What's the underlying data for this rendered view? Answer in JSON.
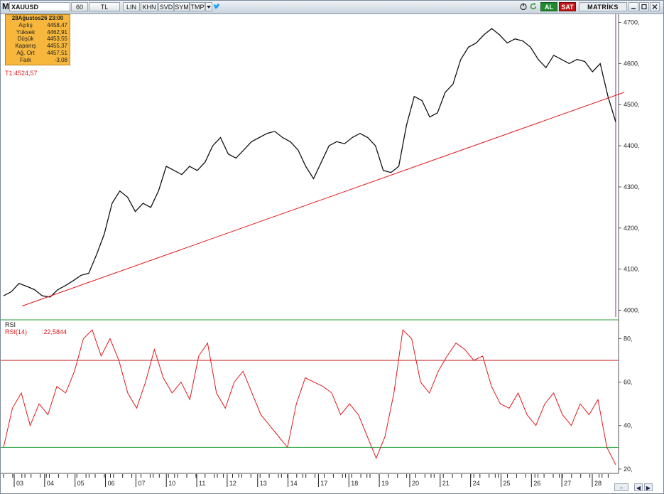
{
  "toolbar": {
    "logo": "M",
    "symbol": "XAUUSD",
    "period": "60",
    "currency": "TL",
    "buttons": [
      "LIN",
      "KHN",
      "SVD",
      "SYM",
      "TMP"
    ],
    "dropdown_icon": "triangle-down-icon",
    "twitter_icon": "twitter-icon",
    "refresh_icon": "refresh-icon",
    "power_icon": "power-icon",
    "buy_label": "AL",
    "sell_label": "SAT",
    "brand": "MATRİKS",
    "window_icons": [
      "minimize-icon",
      "maximize-icon",
      "close-icon"
    ]
  },
  "info": {
    "date": "28Ağustos26 23:00",
    "rows": [
      {
        "label": "Açılış",
        "value": "4458,47"
      },
      {
        "label": "Yüksek",
        "value": "4462,91"
      },
      {
        "label": "Düşük",
        "value": "4453,55"
      },
      {
        "label": "Kapanış",
        "value": "4455,37"
      },
      {
        "label": "Ağ. Ort",
        "value": "4457,51"
      },
      {
        "label": "Fark",
        "value": "-3,08"
      }
    ]
  },
  "colors": {
    "price": "#111111",
    "trendline": "#e0191c",
    "rsi": "#e0191c",
    "rsi_upper": "#c0151a",
    "rsi_lower": "#1e9e35",
    "cursor": "#9a1fb0"
  },
  "chart_data": [
    {
      "type": "line",
      "title": "",
      "trendline_label": "T1:4524,57",
      "ylim": [
        3980,
        4720
      ],
      "yticks": [
        4000,
        4100,
        4200,
        4300,
        4400,
        4500,
        4600,
        4700
      ],
      "ytick_labels": [
        "4000,",
        "4100,",
        "4200,",
        "4300,",
        "4400,",
        "4500,",
        "4600,",
        "4700,"
      ],
      "x_labels": [
        "03",
        "04",
        "05",
        "06",
        "07",
        "10",
        "11",
        "12",
        "13",
        "14",
        "17",
        "18",
        "19",
        "20",
        "21",
        "24",
        "25",
        "26",
        "27",
        "28"
      ],
      "series": [
        {
          "values": [
            4035,
            4045,
            4065,
            4058,
            4050,
            4035,
            4032,
            4050,
            4060,
            4072,
            4085,
            4090,
            4135,
            4185,
            4260,
            4290,
            4275,
            4240,
            4260,
            4250,
            4290,
            4350,
            4340,
            4330,
            4350,
            4340,
            4360,
            4400,
            4420,
            4380,
            4370,
            4390,
            4410,
            4420,
            4430,
            4435,
            4420,
            4410,
            4390,
            4350,
            4320,
            4360,
            4400,
            4410,
            4405,
            4420,
            4430,
            4420,
            4400,
            4340,
            4335,
            4350,
            4450,
            4520,
            4510,
            4470,
            4480,
            4530,
            4550,
            4610,
            4640,
            4650,
            4670,
            4685,
            4670,
            4650,
            4660,
            4655,
            4640,
            4610,
            4590,
            4620,
            4610,
            4600,
            4610,
            4605,
            4580,
            4600,
            4520,
            4458
          ]
        },
        {
          "name": "T1",
          "x": [
            0,
            1
          ],
          "values": [
            4010,
            4530
          ]
        }
      ]
    },
    {
      "type": "line",
      "title": "RSI",
      "series_label": "RSI(14)",
      "value_label": ":22,5844",
      "ylim": [
        18,
        88
      ],
      "yticks": [
        20,
        40,
        60,
        80
      ],
      "ytick_labels": [
        "20,",
        "40,",
        "60,",
        "80,"
      ],
      "levels": [
        70,
        30
      ],
      "x_labels": [
        "03",
        "04",
        "05",
        "06",
        "07",
        "10",
        "11",
        "12",
        "13",
        "14",
        "17",
        "18",
        "19",
        "20",
        "21",
        "24",
        "25",
        "26",
        "27",
        "28"
      ],
      "series": [
        {
          "name": "RSI(14)",
          "values": [
            30,
            48,
            55,
            40,
            50,
            45,
            58,
            55,
            65,
            80,
            84,
            72,
            80,
            70,
            55,
            48,
            60,
            75,
            62,
            55,
            60,
            52,
            72,
            78,
            55,
            48,
            60,
            65,
            55,
            45,
            40,
            35,
            30,
            50,
            62,
            60,
            58,
            55,
            45,
            50,
            45,
            35,
            25,
            35,
            55,
            84,
            80,
            60,
            55,
            65,
            72,
            78,
            75,
            70,
            72,
            58,
            50,
            48,
            55,
            45,
            40,
            50,
            55,
            45,
            40,
            50,
            45,
            52,
            30,
            22
          ]
        }
      ]
    }
  ]
}
